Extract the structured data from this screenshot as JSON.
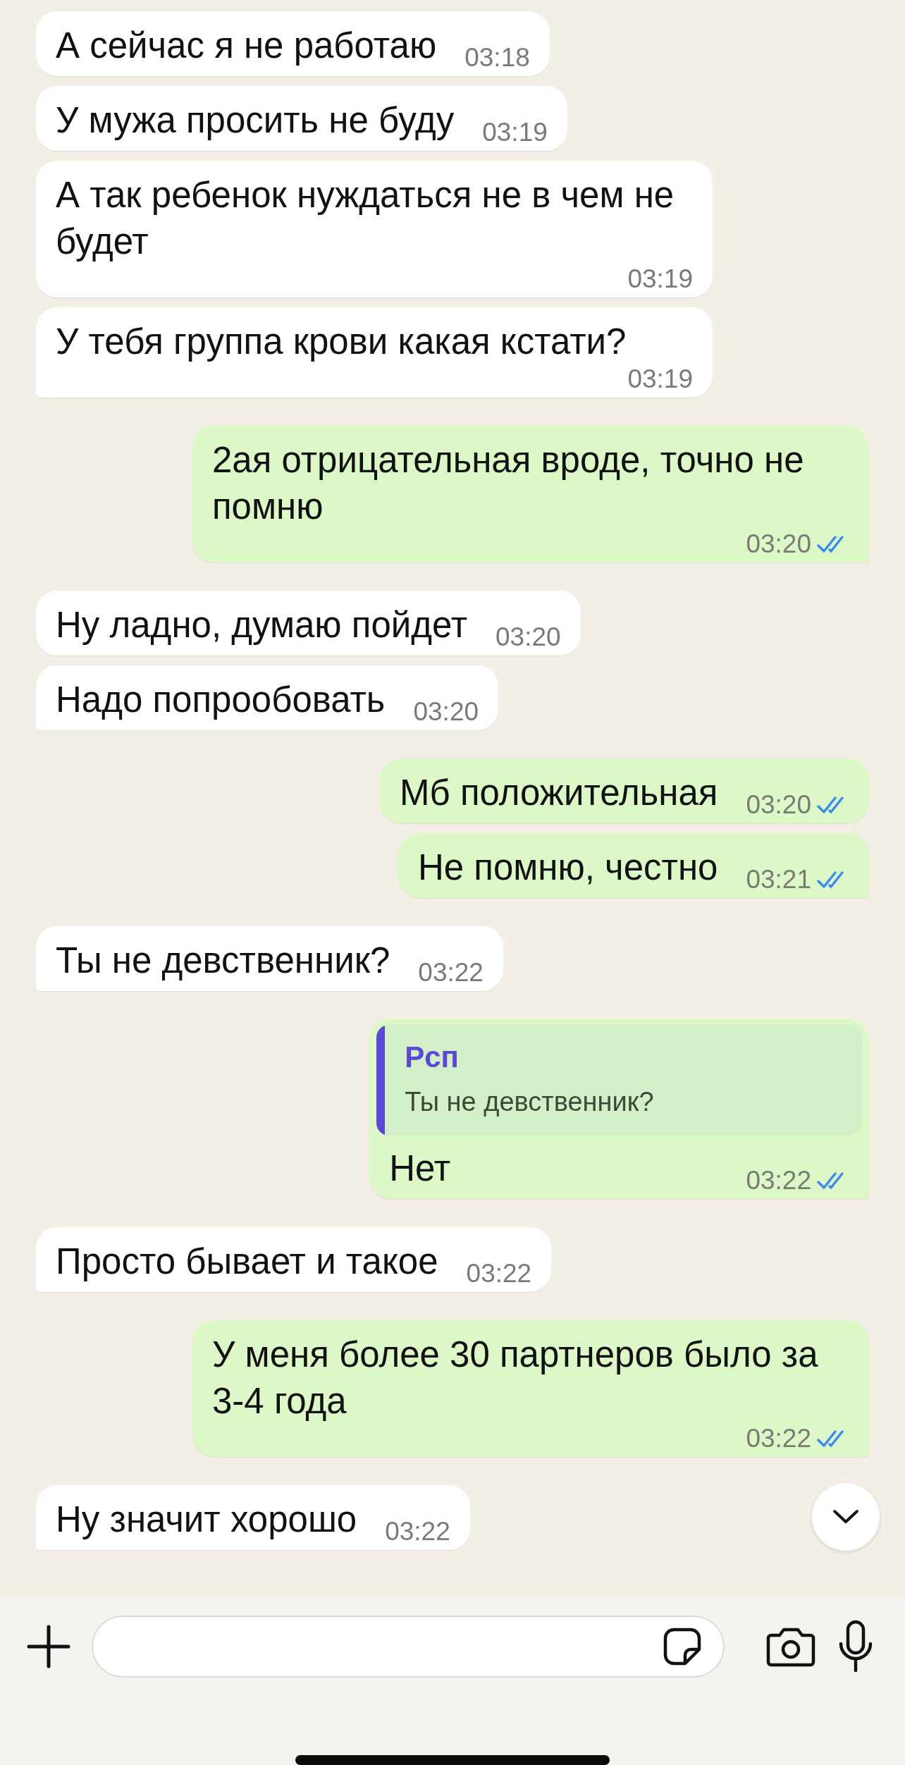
{
  "messages": [
    {
      "kind": "received",
      "text": "А сейчас я не работаю",
      "time": "03:18"
    },
    {
      "kind": "received",
      "text": "У мужа просить не буду",
      "time": "03:19"
    },
    {
      "kind": "received",
      "text": "А так ребенок нуждаться не в чем не будет",
      "time": "03:19"
    },
    {
      "kind": "received",
      "text": "У тебя группа крови какая кстати?",
      "time": "03:19"
    },
    {
      "kind": "sent",
      "text": "2ая отрицательная вроде, точно не помню",
      "time": "03:20",
      "read": true
    },
    {
      "kind": "received",
      "text": "Ну ладно, думаю пойдет",
      "time": "03:20"
    },
    {
      "kind": "received",
      "text": "Надо попрообовать",
      "time": "03:20"
    },
    {
      "kind": "sent",
      "text": "Мб положительная",
      "time": "03:20",
      "read": true
    },
    {
      "kind": "sent",
      "text": "Не помню, честно",
      "time": "03:21",
      "read": true
    },
    {
      "kind": "received",
      "text": "Ты не девственник?",
      "time": "03:22"
    },
    {
      "kind": "sent",
      "text": "Нет",
      "time": "03:22",
      "read": true,
      "reply": {
        "author": "Рсп",
        "text": "Ты не девственник?"
      }
    },
    {
      "kind": "received",
      "text": "Просто бывает и такое",
      "time": "03:22"
    },
    {
      "kind": "sent",
      "text": "У меня более 30 партнеров было за 3-4 года",
      "time": "03:22",
      "read": true
    },
    {
      "kind": "received",
      "text": "Ну значит хорошо",
      "time": "03:22"
    }
  ]
}
